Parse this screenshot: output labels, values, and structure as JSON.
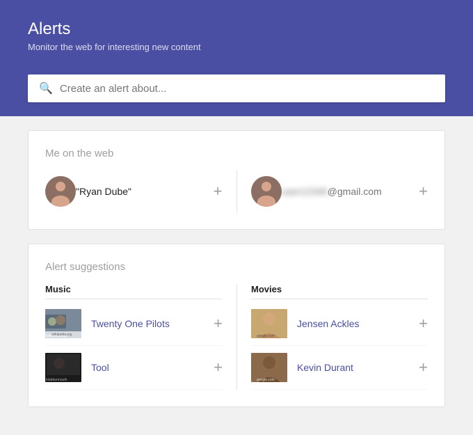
{
  "header": {
    "title": "Alerts",
    "subtitle": "Monitor the web for interesting new content"
  },
  "search": {
    "placeholder": "Create an alert about..."
  },
  "me_on_web": {
    "section_title": "Me on the web",
    "items": [
      {
        "label": "\"Ryan Dube\"",
        "email": false
      },
      {
        "label": "@gmail.com",
        "email": true,
        "blurred": "user123"
      }
    ]
  },
  "alert_suggestions": {
    "section_title": "Alert suggestions",
    "columns": [
      {
        "title": "Music",
        "items": [
          {
            "label": "Twenty One Pilots",
            "source": "wikipedia.org"
          },
          {
            "label": "Tool",
            "source": "blabbermouth"
          }
        ]
      },
      {
        "title": "Movies",
        "items": [
          {
            "label": "Jensen Ackles",
            "source": "google.com"
          },
          {
            "label": "Kevin Durant",
            "source": "google.com"
          }
        ]
      }
    ]
  },
  "icons": {
    "search": "🔍",
    "plus": "+"
  }
}
